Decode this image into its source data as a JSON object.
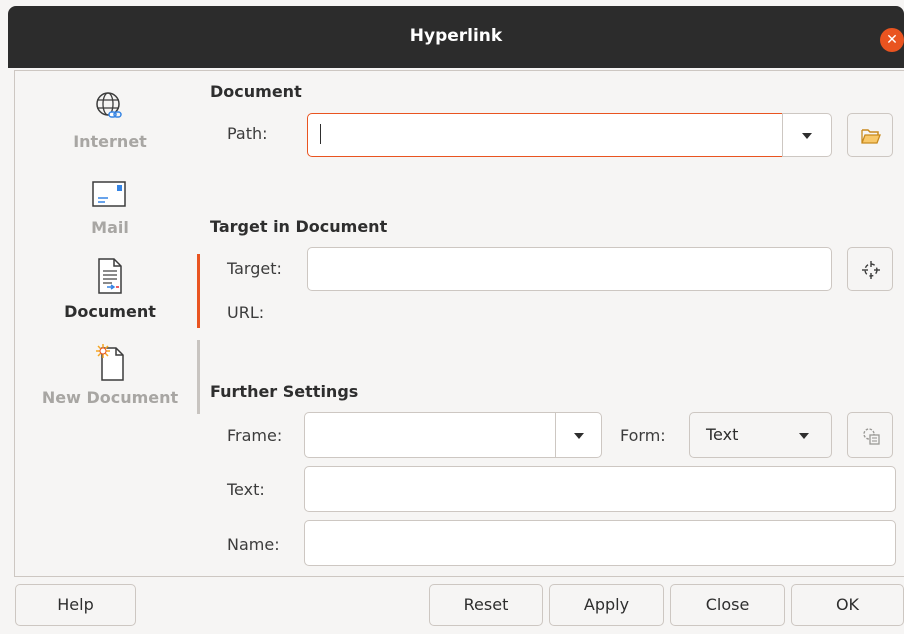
{
  "window": {
    "title": "Hyperlink",
    "close_icon": "close-icon"
  },
  "sidebar": {
    "items": [
      {
        "label": "Internet",
        "icon": "internet-icon",
        "active": false
      },
      {
        "label": "Mail",
        "icon": "mail-icon",
        "active": false
      },
      {
        "label": "Document",
        "icon": "document-icon",
        "active": true
      },
      {
        "label": "New Document",
        "icon": "new-document-icon",
        "active": false
      }
    ]
  },
  "document": {
    "section_title": "Document",
    "path_label": "Path:",
    "path_value": "",
    "open_file_icon": "folder-open-icon"
  },
  "target": {
    "section_title": "Target in Document",
    "target_label": "Target:",
    "target_value": "",
    "url_label": "URL:",
    "target_icon": "target-icon"
  },
  "further": {
    "section_title": "Further Settings",
    "frame_label": "Frame:",
    "frame_value": "",
    "form_label": "Form:",
    "form_value": "Text",
    "events_icon": "events-icon",
    "text_label": "Text:",
    "text_value": "",
    "name_label": "Name:",
    "name_value": ""
  },
  "buttons": {
    "help": "Help",
    "reset": "Reset",
    "apply": "Apply",
    "close": "Close",
    "ok": "OK"
  },
  "colors": {
    "accent": "#e95420",
    "titlebar": "#2c2c2c"
  }
}
